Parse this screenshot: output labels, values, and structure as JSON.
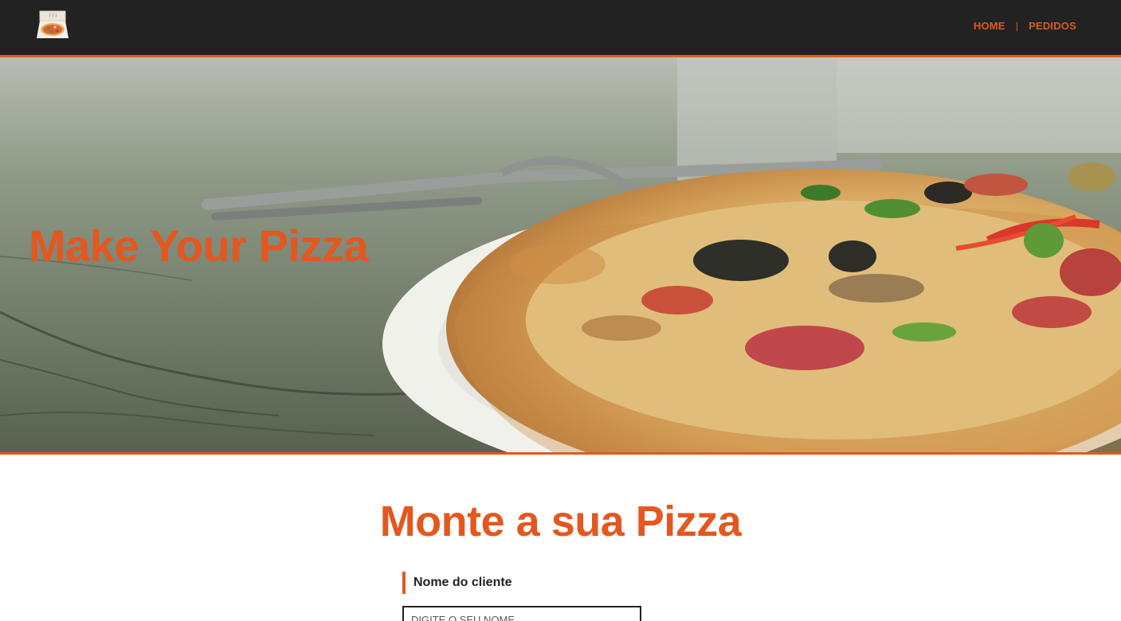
{
  "navbar": {
    "logo_icon": "pizza-box-icon",
    "links": [
      {
        "label": "HOME"
      },
      {
        "label": "PEDIDOS"
      }
    ],
    "separator": "|"
  },
  "hero": {
    "title": "Make Your Pizza"
  },
  "form": {
    "title": "Monte a sua Pizza",
    "name_label": "Nome do cliente",
    "name_placeholder": "DIGITE O SEU NOME",
    "name_value": ""
  },
  "colors": {
    "accent": "#e4571f",
    "navbar_bg": "#222222"
  }
}
